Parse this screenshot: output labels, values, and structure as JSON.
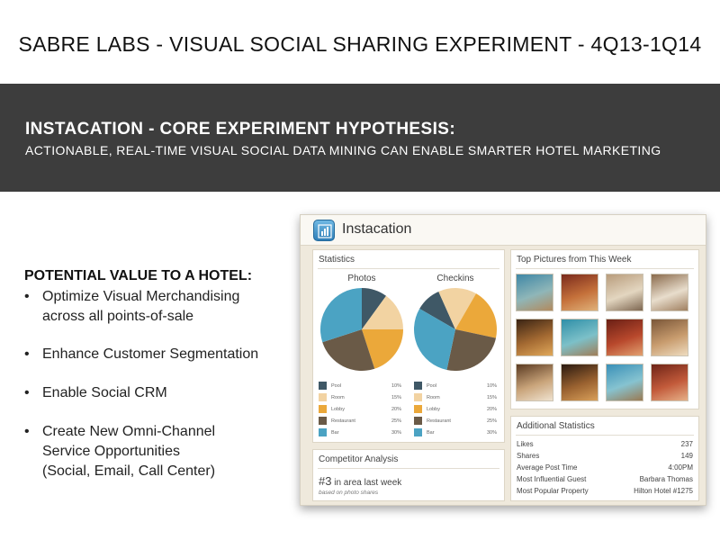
{
  "slide": {
    "title": "SABRE LABS - VISUAL SOCIAL SHARING EXPERIMENT - 4Q13-1Q14",
    "banner_title": "INSTACATION - CORE EXPERIMENT HYPOTHESIS:",
    "banner_subtitle": "ACTIONABLE, REAL-TIME VISUAL SOCIAL DATA MINING CAN ENABLE SMARTER HOTEL MARKETING"
  },
  "value": {
    "heading": "POTENTIAL VALUE TO A HOTEL:",
    "bullet_glyph": "•",
    "items": [
      {
        "line1": "Optimize Visual Merchandising",
        "line2": "across all points-of-sale",
        "line3": ""
      },
      {
        "line1": "Enhance Customer Segmentation",
        "line2": "",
        "line3": ""
      },
      {
        "line1": "Enable Social CRM",
        "line2": "",
        "line3": ""
      },
      {
        "line1": "Create New Omni-Channel",
        "line2": "Service Opportunities",
        "line3": "(Social, Email, Call Center)"
      }
    ]
  },
  "app": {
    "name": "Instacation",
    "icon": "bar-chart-icon",
    "statistics": {
      "title": "Statistics",
      "charts": [
        {
          "title": "Photos",
          "slices": [
            {
              "label": "Pool",
              "pct": "10%",
              "value": 10,
              "color": "#3f5866"
            },
            {
              "label": "Room",
              "pct": "15%",
              "value": 15,
              "color": "#f2d3a2"
            },
            {
              "label": "Lobby",
              "pct": "20%",
              "value": 20,
              "color": "#eba83a"
            },
            {
              "label": "Restaurant",
              "pct": "25%",
              "value": 25,
              "color": "#6a5a47"
            },
            {
              "label": "Bar",
              "pct": "30%",
              "value": 30,
              "color": "#4ba3c3"
            }
          ]
        },
        {
          "title": "Checkins",
          "slices": [
            {
              "label": "Pool",
              "pct": "10%",
              "value": 10,
              "color": "#3f5866"
            },
            {
              "label": "Room",
              "pct": "15%",
              "value": 15,
              "color": "#f2d3a2"
            },
            {
              "label": "Lobby",
              "pct": "20%",
              "value": 20,
              "color": "#eba83a"
            },
            {
              "label": "Restaurant",
              "pct": "25%",
              "value": 25,
              "color": "#6a5a47"
            },
            {
              "label": "Bar",
              "pct": "30%",
              "value": 30,
              "color": "#4ba3c3"
            }
          ]
        }
      ]
    },
    "competitor": {
      "title": "Competitor Analysis",
      "rank": "#3",
      "rank_text": "in area last week",
      "note": "based on photo shares"
    },
    "top_pictures": {
      "title": "Top Pictures from This Week",
      "thumbnails": [
        {
          "name": "pool-photo",
          "colors": [
            "#3f87a6",
            "#8fb6b8",
            "#b28a5e"
          ]
        },
        {
          "name": "restaurant-photo",
          "colors": [
            "#7a2a1c",
            "#c4703a",
            "#e0b27a"
          ]
        },
        {
          "name": "lobby-photo",
          "colors": [
            "#b89c7c",
            "#e3d6c0",
            "#7d6650"
          ]
        },
        {
          "name": "room-photo",
          "colors": [
            "#8a6a4c",
            "#e8ddcc",
            "#a08060"
          ]
        },
        {
          "name": "bar-photo",
          "colors": [
            "#3a2414",
            "#a46a32",
            "#e0a85a"
          ]
        },
        {
          "name": "pool-photo",
          "colors": [
            "#2f8fa8",
            "#7cc0c8",
            "#a07e58"
          ]
        },
        {
          "name": "restaurant-photo",
          "colors": [
            "#6a1f15",
            "#b8482c",
            "#e2a070"
          ]
        },
        {
          "name": "lobby-photo",
          "colors": [
            "#7a5638",
            "#c89c6e",
            "#eedcc0"
          ]
        },
        {
          "name": "room-photo",
          "colors": [
            "#5a3a22",
            "#c9a47a",
            "#efe2cf"
          ]
        },
        {
          "name": "bar-photo",
          "colors": [
            "#2a1a10",
            "#9a6230",
            "#d9a05a"
          ]
        },
        {
          "name": "pool-photo",
          "colors": [
            "#3a90b8",
            "#86c3d0",
            "#9a7a52"
          ]
        },
        {
          "name": "restaurant-photo",
          "colors": [
            "#6e2417",
            "#c25a3a",
            "#e6b088"
          ]
        }
      ]
    },
    "additional": {
      "title": "Additional Statistics",
      "rows": [
        {
          "label": "Likes",
          "value": "237"
        },
        {
          "label": "Shares",
          "value": "149"
        },
        {
          "label": "Average Post Time",
          "value": "4:00PM"
        },
        {
          "label": "Most Influential Guest",
          "value": "Barbara Thomas"
        },
        {
          "label": "Most Popular Property",
          "value": "Hilton Hotel #1275"
        }
      ]
    }
  }
}
